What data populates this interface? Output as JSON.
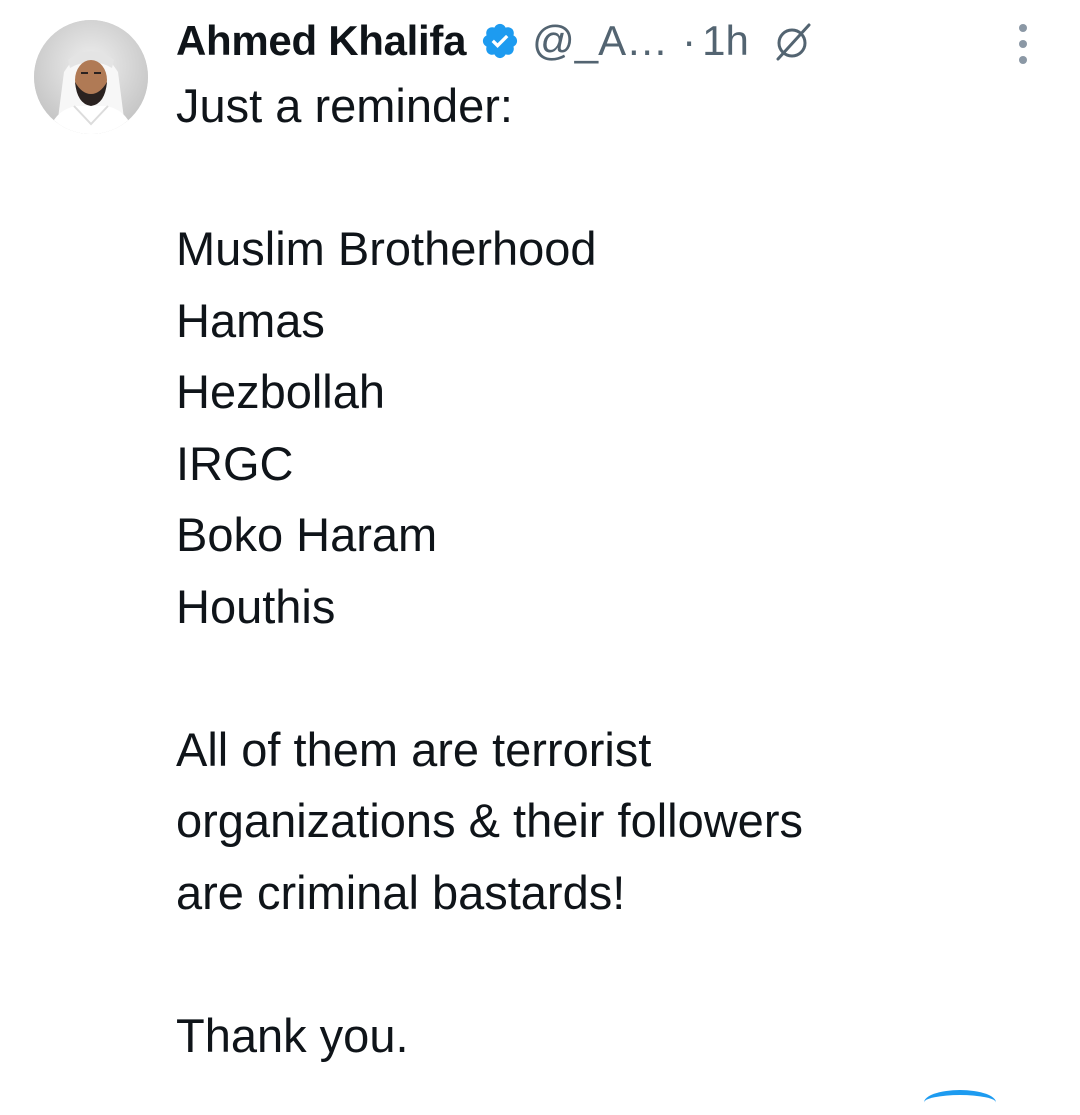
{
  "author": {
    "display_name": "Ahmed Khalifa",
    "handle": "@_A…",
    "verified": true,
    "verified_icon": "verified-badge-icon"
  },
  "meta": {
    "separator": "·",
    "time_ago": "1h",
    "edit_icon": "edited-icon"
  },
  "tweet": {
    "intro": "Just a reminder:",
    "organizations": [
      "Muslim Brotherhood",
      "Hamas",
      "Hezbollah",
      "IRGC",
      "Boko Haram",
      "Houthis"
    ],
    "statement_lines": [
      "All of them are terrorist",
      "organizations & their followers",
      "are criminal bastards!"
    ],
    "closing": "Thank you."
  },
  "colors": {
    "text_primary": "#0f1419",
    "text_secondary": "#536471",
    "accent": "#1d9bf0"
  }
}
